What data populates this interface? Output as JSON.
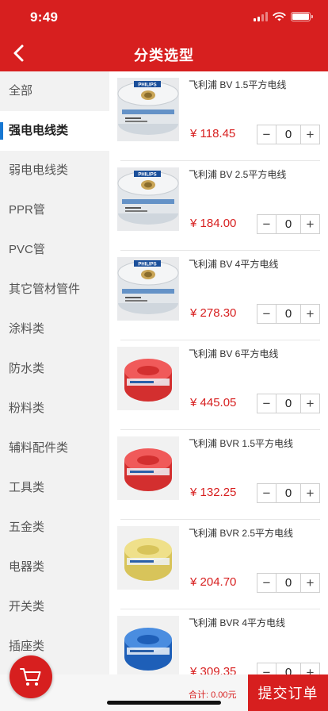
{
  "status_bar": {
    "time": "9:49"
  },
  "nav": {
    "title": "分类选型"
  },
  "colors": {
    "brand_red": "#d71f1f",
    "active_indicator": "#1677d2"
  },
  "categories": [
    {
      "label": "全部",
      "active": false
    },
    {
      "label": "强电电线类",
      "active": true
    },
    {
      "label": "弱电电线类",
      "active": false
    },
    {
      "label": "PPR管",
      "active": false
    },
    {
      "label": "PVC管",
      "active": false
    },
    {
      "label": "其它管材管件",
      "active": false
    },
    {
      "label": "涂料类",
      "active": false
    },
    {
      "label": "防水类",
      "active": false
    },
    {
      "label": "粉料类",
      "active": false
    },
    {
      "label": "辅料配件类",
      "active": false
    },
    {
      "label": "工具类",
      "active": false
    },
    {
      "label": "五金类",
      "active": false
    },
    {
      "label": "电器类",
      "active": false
    },
    {
      "label": "开关类",
      "active": false
    },
    {
      "label": "插座类",
      "active": false
    }
  ],
  "products": [
    {
      "name": "飞利浦 BV 1.5平方电线",
      "price": "¥ 118.45",
      "qty": "0",
      "image": "philips-spool"
    },
    {
      "name": "飞利浦 BV 2.5平方电线",
      "price": "¥ 184.00",
      "qty": "0",
      "image": "philips-spool"
    },
    {
      "name": "飞利浦 BV 4平方电线",
      "price": "¥ 278.30",
      "qty": "0",
      "image": "philips-spool"
    },
    {
      "name": "飞利浦 BV 6平方电线",
      "price": "¥ 445.05",
      "qty": "0",
      "image": "red-coil"
    },
    {
      "name": "飞利浦 BVR 1.5平方电线",
      "price": "¥ 132.25",
      "qty": "0",
      "image": "red-coil"
    },
    {
      "name": "飞利浦 BVR 2.5平方电线",
      "price": "¥ 204.70",
      "qty": "0",
      "image": "yellow-coil"
    },
    {
      "name": "飞利浦 BVR 4平方电线",
      "price": "¥ 309.35",
      "qty": "0",
      "image": "blue-coil"
    }
  ],
  "stepper": {
    "minus": "−",
    "plus": "+"
  },
  "footer": {
    "total": "合计: 0.00元",
    "submit_label": "提交订单"
  },
  "brand_label": "PHILIPS",
  "icons": {
    "back": "chevron-left-icon",
    "cart": "cart-icon",
    "wifi": "wifi-icon",
    "battery": "battery-icon",
    "signal": "signal-icon"
  }
}
